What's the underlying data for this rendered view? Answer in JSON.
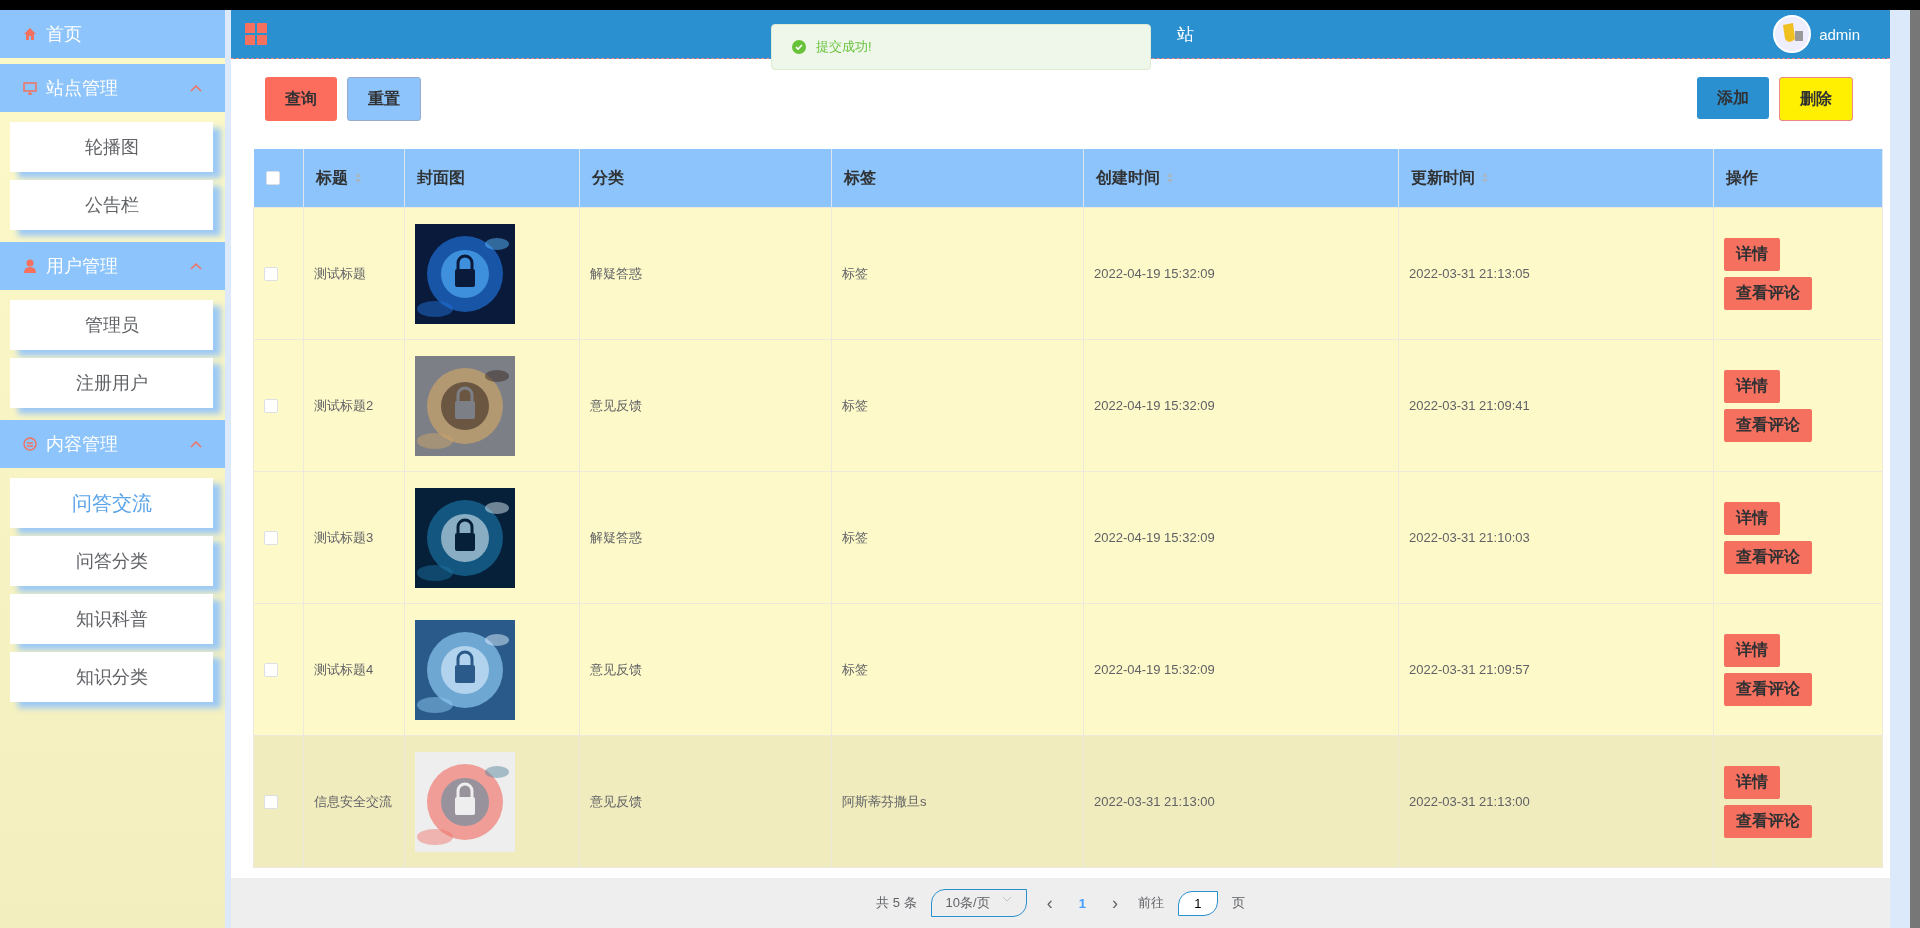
{
  "sidebar": {
    "items": [
      {
        "kind": "link",
        "label": "首页"
      },
      {
        "kind": "group",
        "label": "站点管理",
        "expanded": true,
        "children": [
          {
            "label": "轮播图",
            "selected": false
          },
          {
            "label": "公告栏",
            "selected": false
          }
        ]
      },
      {
        "kind": "group",
        "label": "用户管理",
        "expanded": true,
        "children": [
          {
            "label": "管理员",
            "selected": false
          },
          {
            "label": "注册用户",
            "selected": false
          }
        ]
      },
      {
        "kind": "group",
        "label": "内容管理",
        "expanded": true,
        "children": [
          {
            "label": "问答交流",
            "selected": true
          },
          {
            "label": "问答分类",
            "selected": false
          },
          {
            "label": "知识科普",
            "selected": false
          },
          {
            "label": "知识分类",
            "selected": false
          }
        ]
      }
    ]
  },
  "header": {
    "title": "站",
    "user": "admin"
  },
  "toast": {
    "message": "提交成功!"
  },
  "toolbar": {
    "left": [
      "查询",
      "重置"
    ],
    "right": [
      "添加",
      "删除"
    ]
  },
  "table": {
    "select_all_checked": false,
    "columns": [
      {
        "label": "标题",
        "sortable": true
      },
      {
        "label": "封面图",
        "sortable": false
      },
      {
        "label": "分类",
        "sortable": false
      },
      {
        "label": "标签",
        "sortable": false
      },
      {
        "label": "创建时间",
        "sortable": true
      },
      {
        "label": "更新时间",
        "sortable": true
      },
      {
        "label": "操作",
        "sortable": false
      }
    ],
    "rows": [
      {
        "checked": false,
        "title": "测试标题",
        "category": "解疑答惑",
        "tag": "标签",
        "created": "2022-04-19 15:32:09",
        "updated": "2022-03-31 21:13:05",
        "actions": [
          "详情",
          "查看评论"
        ]
      },
      {
        "checked": false,
        "title": "测试标题2",
        "category": "意见反馈",
        "tag": "标签",
        "created": "2022-04-19 15:32:09",
        "updated": "2022-03-31 21:09:41",
        "actions": [
          "详情",
          "查看评论"
        ]
      },
      {
        "checked": false,
        "title": "测试标题3",
        "category": "解疑答惑",
        "tag": "标签",
        "created": "2022-04-19 15:32:09",
        "updated": "2022-03-31 21:10:03",
        "actions": [
          "详情",
          "查看评论"
        ]
      },
      {
        "checked": false,
        "title": "测试标题4",
        "category": "意见反馈",
        "tag": "标签",
        "created": "2022-04-19 15:32:09",
        "updated": "2022-03-31 21:09:57",
        "actions": [
          "详情",
          "查看评论"
        ]
      },
      {
        "checked": false,
        "title": "信息安全交流",
        "category": "意见反馈",
        "tag": "阿斯蒂芬撒旦s",
        "created": "2022-03-31 21:13:00",
        "updated": "2022-03-31 21:13:00",
        "actions": [
          "详情",
          "查看评论"
        ]
      }
    ]
  },
  "pagination": {
    "total": "共 5 条",
    "page_size": "10条/页",
    "prev": "‹",
    "pages": [
      {
        "label": "1",
        "selected": true
      }
    ],
    "next": "›",
    "goto_label": "前往",
    "goto_value": "1",
    "goto_suffix": "页"
  }
}
